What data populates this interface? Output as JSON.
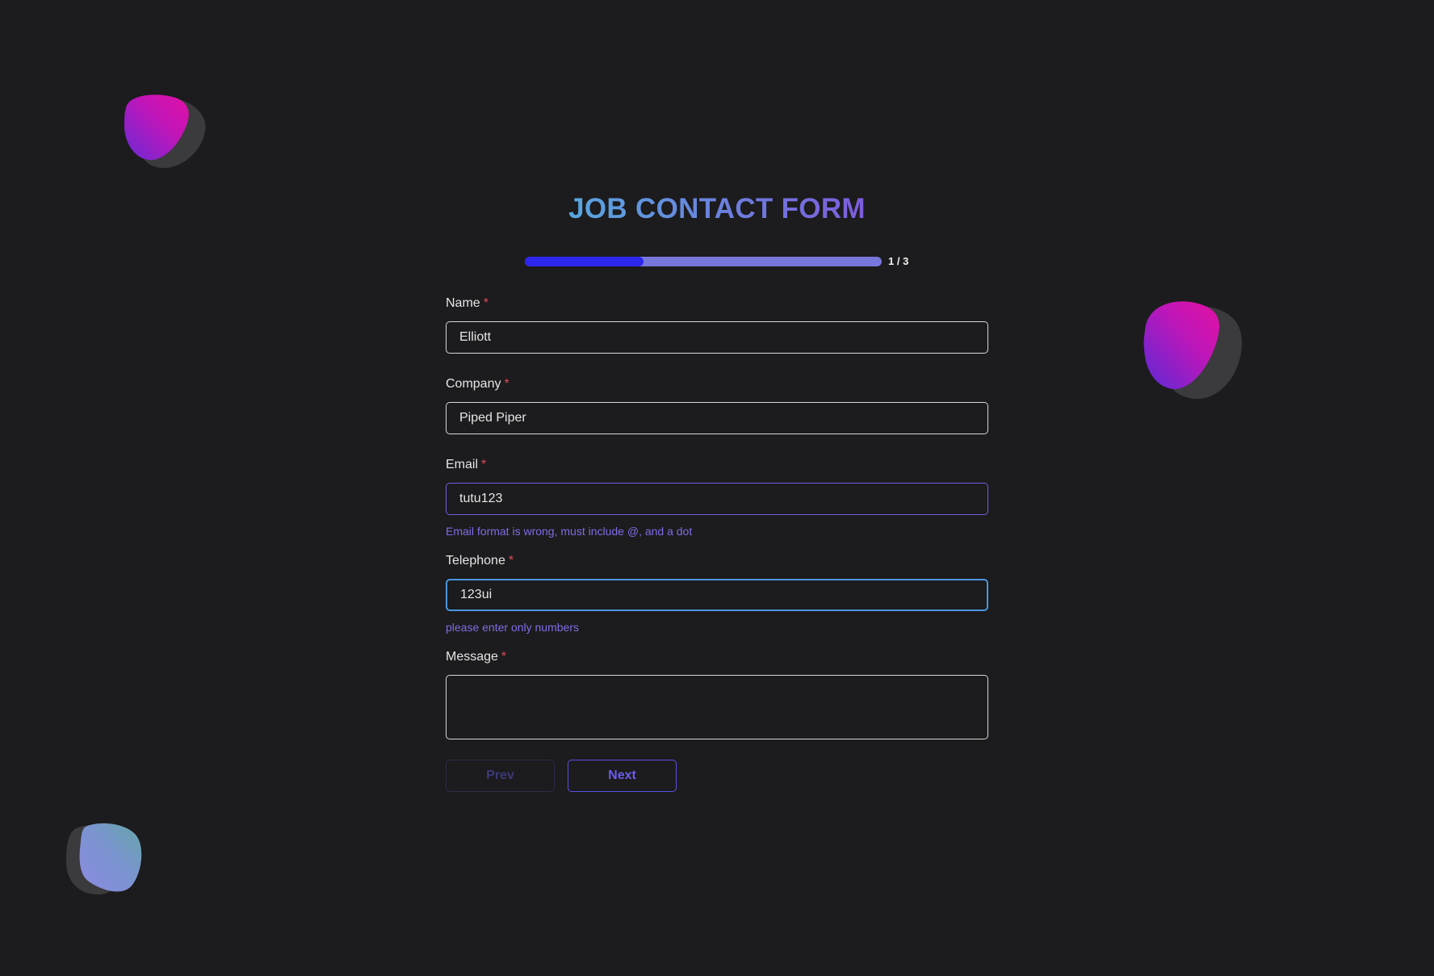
{
  "form": {
    "title": "JOB CONTACT FORM",
    "progress": {
      "current": 1,
      "total": 3,
      "label": "1 / 3",
      "fraction": 0.333
    },
    "required_marker": "*",
    "fields": {
      "name": {
        "label": "Name",
        "value": "Elliott"
      },
      "company": {
        "label": "Company",
        "value": "Piped Piper"
      },
      "email": {
        "label": "Email",
        "value": "tutu123",
        "error": "Email format is wrong, must include @, and a dot"
      },
      "telephone": {
        "label": "Telephone",
        "value": "123ui",
        "error": "please enter only numbers"
      },
      "message": {
        "label": "Message",
        "value": ""
      }
    },
    "buttons": {
      "prev": "Prev",
      "next": "Next"
    }
  },
  "colors": {
    "background": "#1c1b1d",
    "accent": "#6b5cf0",
    "progress_fill": "#2d27ee",
    "progress_track": "#7777db",
    "error_text": "#7e6ee6",
    "required": "#e0485b",
    "focus_border": "#4a97e0"
  }
}
